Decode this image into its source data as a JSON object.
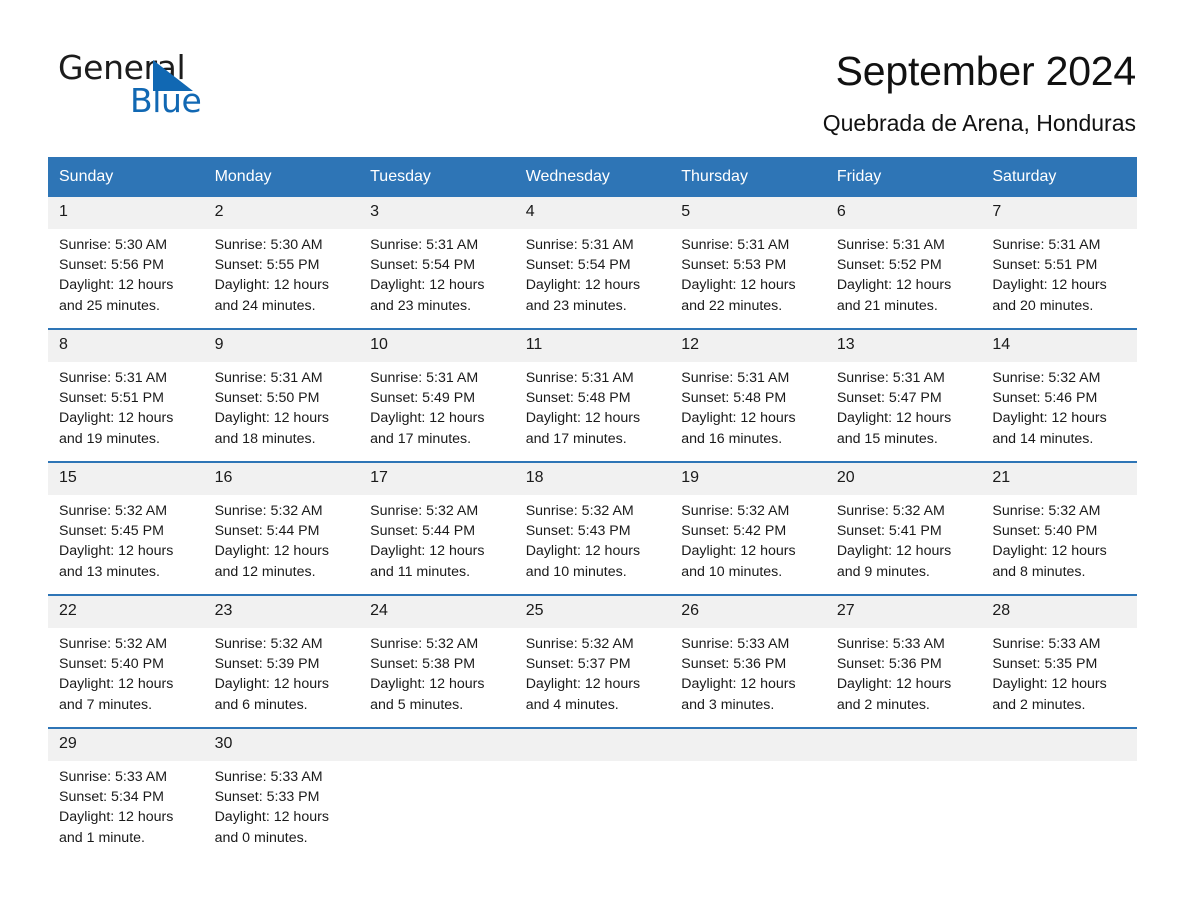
{
  "brand": {
    "word_one": "General",
    "word_two": "Blue",
    "triangle_color": "#1168b3"
  },
  "header": {
    "title": "September 2024",
    "location": "Quebrada de Arena, Honduras",
    "accent_color": "#2e75b6",
    "daynum_band_color": "#f1f1f1"
  },
  "weekdays": [
    "Sunday",
    "Monday",
    "Tuesday",
    "Wednesday",
    "Thursday",
    "Friday",
    "Saturday"
  ],
  "weeks": [
    {
      "days": [
        {
          "num": "1",
          "sunrise": "Sunrise: 5:30 AM",
          "sunset": "Sunset: 5:56 PM",
          "daylight_1": "Daylight: 12 hours",
          "daylight_2": "and 25 minutes."
        },
        {
          "num": "2",
          "sunrise": "Sunrise: 5:30 AM",
          "sunset": "Sunset: 5:55 PM",
          "daylight_1": "Daylight: 12 hours",
          "daylight_2": "and 24 minutes."
        },
        {
          "num": "3",
          "sunrise": "Sunrise: 5:31 AM",
          "sunset": "Sunset: 5:54 PM",
          "daylight_1": "Daylight: 12 hours",
          "daylight_2": "and 23 minutes."
        },
        {
          "num": "4",
          "sunrise": "Sunrise: 5:31 AM",
          "sunset": "Sunset: 5:54 PM",
          "daylight_1": "Daylight: 12 hours",
          "daylight_2": "and 23 minutes."
        },
        {
          "num": "5",
          "sunrise": "Sunrise: 5:31 AM",
          "sunset": "Sunset: 5:53 PM",
          "daylight_1": "Daylight: 12 hours",
          "daylight_2": "and 22 minutes."
        },
        {
          "num": "6",
          "sunrise": "Sunrise: 5:31 AM",
          "sunset": "Sunset: 5:52 PM",
          "daylight_1": "Daylight: 12 hours",
          "daylight_2": "and 21 minutes."
        },
        {
          "num": "7",
          "sunrise": "Sunrise: 5:31 AM",
          "sunset": "Sunset: 5:51 PM",
          "daylight_1": "Daylight: 12 hours",
          "daylight_2": "and 20 minutes."
        }
      ]
    },
    {
      "days": [
        {
          "num": "8",
          "sunrise": "Sunrise: 5:31 AM",
          "sunset": "Sunset: 5:51 PM",
          "daylight_1": "Daylight: 12 hours",
          "daylight_2": "and 19 minutes."
        },
        {
          "num": "9",
          "sunrise": "Sunrise: 5:31 AM",
          "sunset": "Sunset: 5:50 PM",
          "daylight_1": "Daylight: 12 hours",
          "daylight_2": "and 18 minutes."
        },
        {
          "num": "10",
          "sunrise": "Sunrise: 5:31 AM",
          "sunset": "Sunset: 5:49 PM",
          "daylight_1": "Daylight: 12 hours",
          "daylight_2": "and 17 minutes."
        },
        {
          "num": "11",
          "sunrise": "Sunrise: 5:31 AM",
          "sunset": "Sunset: 5:48 PM",
          "daylight_1": "Daylight: 12 hours",
          "daylight_2": "and 17 minutes."
        },
        {
          "num": "12",
          "sunrise": "Sunrise: 5:31 AM",
          "sunset": "Sunset: 5:48 PM",
          "daylight_1": "Daylight: 12 hours",
          "daylight_2": "and 16 minutes."
        },
        {
          "num": "13",
          "sunrise": "Sunrise: 5:31 AM",
          "sunset": "Sunset: 5:47 PM",
          "daylight_1": "Daylight: 12 hours",
          "daylight_2": "and 15 minutes."
        },
        {
          "num": "14",
          "sunrise": "Sunrise: 5:32 AM",
          "sunset": "Sunset: 5:46 PM",
          "daylight_1": "Daylight: 12 hours",
          "daylight_2": "and 14 minutes."
        }
      ]
    },
    {
      "days": [
        {
          "num": "15",
          "sunrise": "Sunrise: 5:32 AM",
          "sunset": "Sunset: 5:45 PM",
          "daylight_1": "Daylight: 12 hours",
          "daylight_2": "and 13 minutes."
        },
        {
          "num": "16",
          "sunrise": "Sunrise: 5:32 AM",
          "sunset": "Sunset: 5:44 PM",
          "daylight_1": "Daylight: 12 hours",
          "daylight_2": "and 12 minutes."
        },
        {
          "num": "17",
          "sunrise": "Sunrise: 5:32 AM",
          "sunset": "Sunset: 5:44 PM",
          "daylight_1": "Daylight: 12 hours",
          "daylight_2": "and 11 minutes."
        },
        {
          "num": "18",
          "sunrise": "Sunrise: 5:32 AM",
          "sunset": "Sunset: 5:43 PM",
          "daylight_1": "Daylight: 12 hours",
          "daylight_2": "and 10 minutes."
        },
        {
          "num": "19",
          "sunrise": "Sunrise: 5:32 AM",
          "sunset": "Sunset: 5:42 PM",
          "daylight_1": "Daylight: 12 hours",
          "daylight_2": "and 10 minutes."
        },
        {
          "num": "20",
          "sunrise": "Sunrise: 5:32 AM",
          "sunset": "Sunset: 5:41 PM",
          "daylight_1": "Daylight: 12 hours",
          "daylight_2": "and 9 minutes."
        },
        {
          "num": "21",
          "sunrise": "Sunrise: 5:32 AM",
          "sunset": "Sunset: 5:40 PM",
          "daylight_1": "Daylight: 12 hours",
          "daylight_2": "and 8 minutes."
        }
      ]
    },
    {
      "days": [
        {
          "num": "22",
          "sunrise": "Sunrise: 5:32 AM",
          "sunset": "Sunset: 5:40 PM",
          "daylight_1": "Daylight: 12 hours",
          "daylight_2": "and 7 minutes."
        },
        {
          "num": "23",
          "sunrise": "Sunrise: 5:32 AM",
          "sunset": "Sunset: 5:39 PM",
          "daylight_1": "Daylight: 12 hours",
          "daylight_2": "and 6 minutes."
        },
        {
          "num": "24",
          "sunrise": "Sunrise: 5:32 AM",
          "sunset": "Sunset: 5:38 PM",
          "daylight_1": "Daylight: 12 hours",
          "daylight_2": "and 5 minutes."
        },
        {
          "num": "25",
          "sunrise": "Sunrise: 5:32 AM",
          "sunset": "Sunset: 5:37 PM",
          "daylight_1": "Daylight: 12 hours",
          "daylight_2": "and 4 minutes."
        },
        {
          "num": "26",
          "sunrise": "Sunrise: 5:33 AM",
          "sunset": "Sunset: 5:36 PM",
          "daylight_1": "Daylight: 12 hours",
          "daylight_2": "and 3 minutes."
        },
        {
          "num": "27",
          "sunrise": "Sunrise: 5:33 AM",
          "sunset": "Sunset: 5:36 PM",
          "daylight_1": "Daylight: 12 hours",
          "daylight_2": "and 2 minutes."
        },
        {
          "num": "28",
          "sunrise": "Sunrise: 5:33 AM",
          "sunset": "Sunset: 5:35 PM",
          "daylight_1": "Daylight: 12 hours",
          "daylight_2": "and 2 minutes."
        }
      ]
    },
    {
      "days": [
        {
          "num": "29",
          "sunrise": "Sunrise: 5:33 AM",
          "sunset": "Sunset: 5:34 PM",
          "daylight_1": "Daylight: 12 hours",
          "daylight_2": "and 1 minute."
        },
        {
          "num": "30",
          "sunrise": "Sunrise: 5:33 AM",
          "sunset": "Sunset: 5:33 PM",
          "daylight_1": "Daylight: 12 hours",
          "daylight_2": "and 0 minutes."
        },
        {
          "num": "",
          "sunrise": "",
          "sunset": "",
          "daylight_1": "",
          "daylight_2": ""
        },
        {
          "num": "",
          "sunrise": "",
          "sunset": "",
          "daylight_1": "",
          "daylight_2": ""
        },
        {
          "num": "",
          "sunrise": "",
          "sunset": "",
          "daylight_1": "",
          "daylight_2": ""
        },
        {
          "num": "",
          "sunrise": "",
          "sunset": "",
          "daylight_1": "",
          "daylight_2": ""
        },
        {
          "num": "",
          "sunrise": "",
          "sunset": "",
          "daylight_1": "",
          "daylight_2": ""
        }
      ]
    }
  ]
}
